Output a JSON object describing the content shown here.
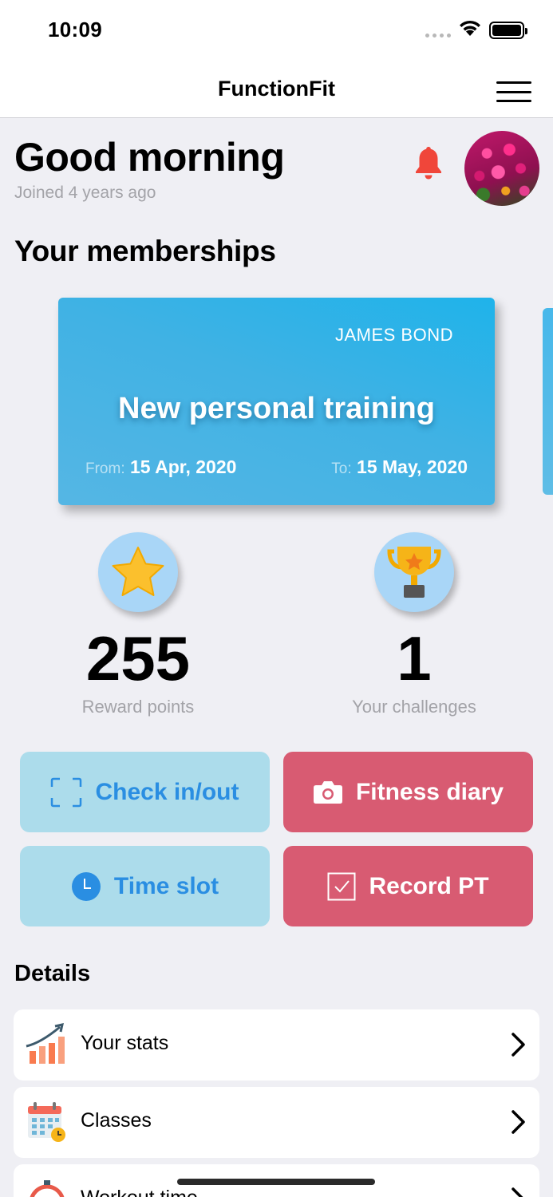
{
  "status_bar": {
    "time": "10:09"
  },
  "nav": {
    "title": "FunctionFit",
    "menu_icon": "hamburger-menu-icon"
  },
  "header": {
    "greeting": "Good morning",
    "joined": "Joined 4 years ago",
    "bell_icon": "bell-icon",
    "bell_color": "#f0463a"
  },
  "memberships": {
    "section_title": "Your memberships",
    "card": {
      "holder": "JAMES BOND",
      "title": "New personal training",
      "from_label": "From:",
      "from_date": "15 Apr, 2020",
      "to_label": "To:",
      "to_date": "15 May, 2020",
      "color": "#2bb1e8"
    }
  },
  "stats": {
    "rewards": {
      "icon": "star-icon",
      "value": "255",
      "label": "Reward points"
    },
    "challenges": {
      "icon": "trophy-icon",
      "value": "1",
      "label": "Your challenges"
    }
  },
  "actions": {
    "check_in": {
      "label": "Check in/out",
      "icon": "scan-frame-icon"
    },
    "fitness_diary": {
      "label": "Fitness diary",
      "icon": "camera-icon"
    },
    "time_slot": {
      "label": "Time slot",
      "icon": "clock-icon"
    },
    "record_pt": {
      "label": "Record PT",
      "icon": "checkbox-icon"
    },
    "blue_color": "#acdceb",
    "red_color": "#d85b72"
  },
  "details": {
    "title": "Details",
    "items": [
      {
        "label": "Your stats",
        "icon": "chart-growth-icon"
      },
      {
        "label": "Classes",
        "icon": "calendar-icon"
      },
      {
        "label": "Workout time",
        "icon": "stopwatch-icon"
      }
    ]
  }
}
